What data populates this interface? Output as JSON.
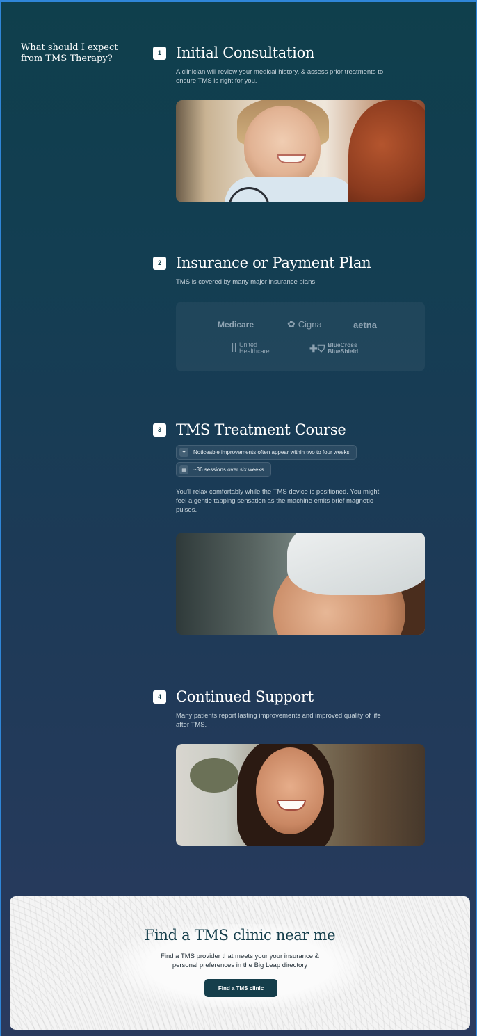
{
  "intro": {
    "heading": "What should I expect from TMS Therapy?"
  },
  "steps": [
    {
      "number": "1",
      "title": "Initial Consultation",
      "description": "A clinician will review your medical history, & assess prior treatments to ensure TMS is right for you."
    },
    {
      "number": "2",
      "title": "Insurance or Payment Plan",
      "description": "TMS is covered by many major insurance plans.",
      "logos": [
        "Medicare",
        "Cigna",
        "aetna",
        "United Healthcare",
        "BlueCross BlueShield"
      ]
    },
    {
      "number": "3",
      "title": "TMS Treatment Course",
      "pills": [
        {
          "icon": "sparkle-icon",
          "text": "Noticeable improvements often appear within two to four weeks"
        },
        {
          "icon": "calendar-icon",
          "text": "~36 sessions over six weeks"
        }
      ],
      "description": "You'll relax comfortably while the TMS device is positioned. You might feel a gentle tapping sensation as the machine emits brief magnetic pulses."
    },
    {
      "number": "4",
      "title": "Continued Support",
      "description": "Many patients report lasting improvements and improved quality of life after TMS."
    }
  ],
  "cta": {
    "title": "Find a TMS clinic near me",
    "description": "Find a TMS provider that meets your your insurance & personal preferences in the Big Leap directory",
    "button_label": "Find a TMS clinic"
  },
  "colors": {
    "background_top": "#0f3f4c",
    "background_bottom": "#2a3a5e",
    "accent": "#153e4b",
    "logo_gray": "#8ea3b2"
  }
}
